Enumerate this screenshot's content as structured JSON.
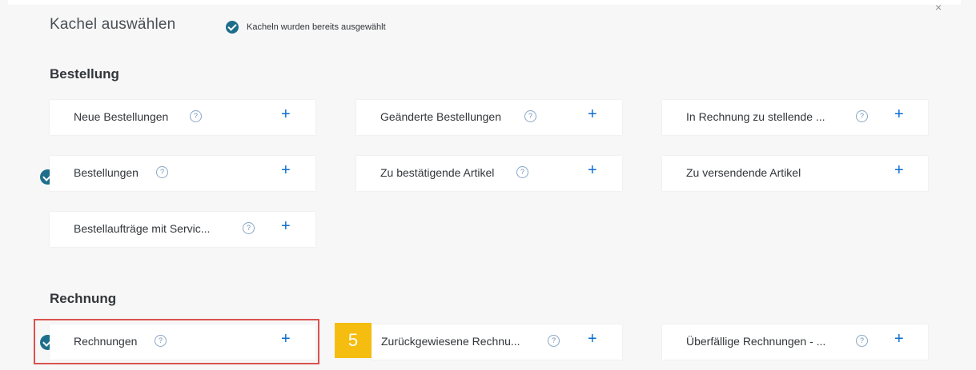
{
  "dialog": {
    "title": "Kachel auswählen",
    "note": "Kacheln wurden bereits ausgewählt",
    "close": "×"
  },
  "sections": [
    {
      "heading": "Bestellung",
      "tiles": [
        {
          "label": "Neue Bestellungen",
          "help": "?",
          "plus": "+",
          "selected": false
        },
        {
          "label": "Geänderte Bestellungen",
          "help": "?",
          "plus": "+",
          "selected": false
        },
        {
          "label": "In Rechnung zu stellende ...",
          "help": "?",
          "plus": "+",
          "selected": false
        },
        {
          "label": "Bestellungen",
          "help": "?",
          "plus": "+",
          "selected": true
        },
        {
          "label": "Zu bestätigende Artikel",
          "help": "?",
          "plus": "+",
          "selected": false
        },
        {
          "label": "Zu versendende Artikel",
          "plus": "+",
          "selected": false
        },
        {
          "label": "Bestellaufträge mit Servic...",
          "help": "?",
          "plus": "+",
          "selected": false
        }
      ]
    },
    {
      "heading": "Rechnung",
      "tiles": [
        {
          "label": "Rechnungen",
          "help": "?",
          "plus": "+",
          "selected": true
        },
        {
          "label": "Zurückgewiesene Rechnu...",
          "help": "?",
          "plus": "+",
          "selected": false
        },
        {
          "label": "Überfällige Rechnungen - ...",
          "help": "?",
          "plus": "+",
          "selected": false
        }
      ]
    }
  ],
  "callout": {
    "step": "5",
    "color": "#f5bd0f"
  },
  "colors": {
    "accent": "#0a6ed1",
    "check": "#1d6e8b",
    "highlight": "#d9534f"
  }
}
